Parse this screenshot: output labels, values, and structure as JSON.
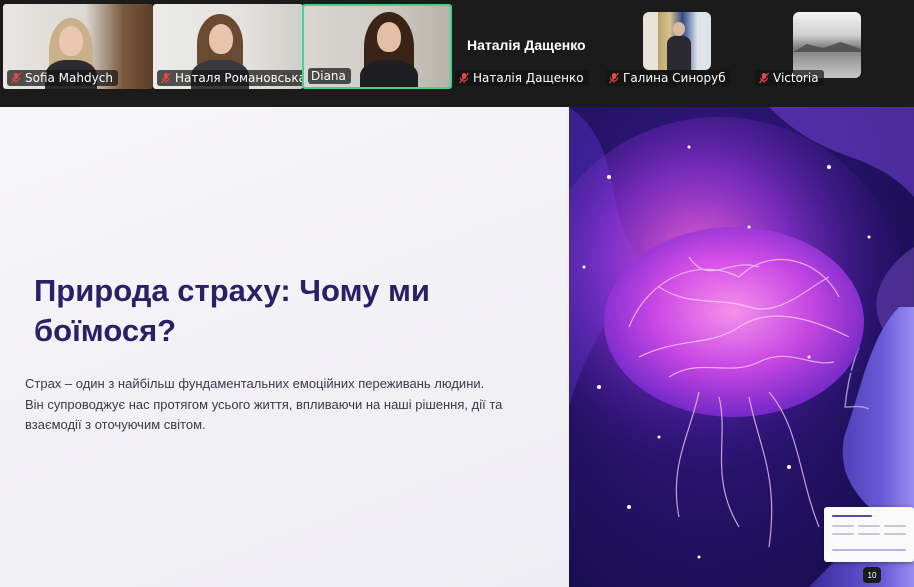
{
  "participants": [
    {
      "name": "Sofia Mahdych",
      "muted": true
    },
    {
      "name": "Наталя Романовська",
      "muted": true
    },
    {
      "name": "Diana",
      "muted": false,
      "speaking": true
    },
    {
      "name": "Наталія Дащенко",
      "muted": true
    },
    {
      "name": "Галина Синоруб",
      "muted": true
    },
    {
      "name": "Victoria",
      "muted": true
    }
  ],
  "featured_name": "Наталія Дащенко",
  "slide": {
    "title": "Природа страху: Чому ми боїмося?",
    "body": "Страх – один з найбільш фундаментальних емоційних переживань людини. Він супроводжує нас протягом усього життя, впливаючи на наші рішення, дії та взаємодії з оточуючим світом.",
    "page_number": "10"
  },
  "colors": {
    "title": "#2b1f66",
    "speaking_border": "#3fd68a",
    "muted_icon": "#e54848"
  }
}
